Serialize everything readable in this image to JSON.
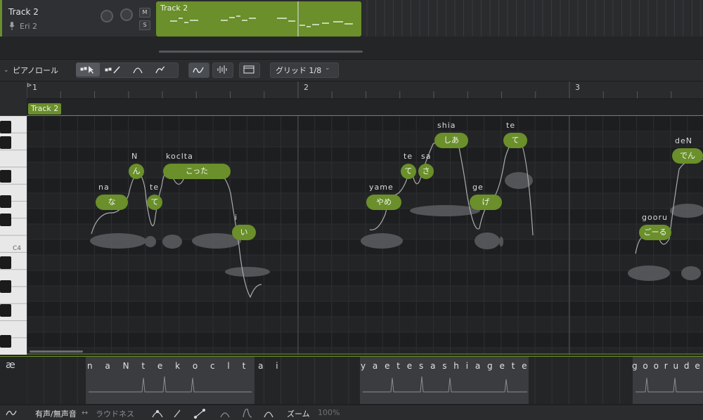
{
  "track": {
    "name": "Track 2",
    "singer": "Eri 2",
    "mute_label": "M",
    "solo_label": "S"
  },
  "region": {
    "label": "Track 2"
  },
  "toolbar": {
    "title": "ピアノロール",
    "grid": "グリッド 1/8"
  },
  "ruler": {
    "bars": [
      "1",
      "2",
      "3"
    ]
  },
  "piano": {
    "c4": "C4"
  },
  "track_tag": "Track 2",
  "notes": [
    {
      "lyric": "な",
      "phoneme": "na"
    },
    {
      "lyric": "ん",
      "phoneme": "N"
    },
    {
      "lyric": "て",
      "phoneme": "te"
    },
    {
      "lyric": "こった",
      "phoneme": "koclta"
    },
    {
      "lyric": "い",
      "phoneme": "i"
    },
    {
      "lyric": "やめ",
      "phoneme": "yame"
    },
    {
      "lyric": "て",
      "phoneme": "te"
    },
    {
      "lyric": "さ",
      "phoneme": "sa"
    },
    {
      "lyric": "しあ",
      "phoneme": "shia"
    },
    {
      "lyric": "げ",
      "phoneme": "ge"
    },
    {
      "lyric": "て",
      "phoneme": "te"
    },
    {
      "lyric": "ごーる",
      "phoneme": "gooru"
    },
    {
      "lyric": "でん",
      "phoneme": "deN"
    }
  ],
  "phoneme_lane": {
    "icon": "æ",
    "groups": [
      "n a N t e k o c l t a i",
      "y a e t e s a s h i a g e t e",
      "g o o r u d e N w"
    ]
  },
  "bottom": {
    "voiced": "有声/無声音",
    "loudness": "ラウドネス",
    "zoom": "ズーム",
    "zoom_value": "100%"
  },
  "colors": {
    "accent": "#6a8f2b",
    "background": "#202122"
  }
}
